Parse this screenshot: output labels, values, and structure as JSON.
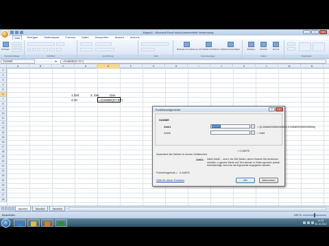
{
  "window": {
    "title": "Mappe1 - Microsoft Excel nicht-kommerzielle Verwendung"
  },
  "ribbon": {
    "tabs": [
      "Start",
      "Einfügen",
      "Seitenlayout",
      "Formeln",
      "Daten",
      "Überprüfen",
      "Ansicht",
      "Add-Ins"
    ],
    "groups": [
      "Zwischenablage",
      "Schriftart",
      "Ausrichtung",
      "Zahl",
      "Formatvorlagen",
      "Zellen",
      "Bearbeiten"
    ],
    "paste_label": "Einfügen",
    "style_buttons": [
      "Bedingte Formatierung",
      "Als Tabelle formatieren",
      "Zellenformatvorlagen"
    ],
    "cell_buttons": [
      "Einfügen",
      "Löschen",
      "Format"
    ]
  },
  "formula_bar": {
    "name_box": "SUMME",
    "fx": "fx",
    "content": "=SUMME(D7:E7)"
  },
  "sheet": {
    "columns": [
      "A",
      "B",
      "C",
      "D",
      "E",
      "F",
      "G",
      "H",
      "I",
      "J",
      "K",
      "L",
      "M",
      "N"
    ],
    "rows": [
      "1",
      "2",
      "3",
      "4",
      "5",
      "6",
      "7",
      "8",
      "9",
      "10",
      "11",
      "12",
      "13",
      "14",
      "15",
      "16",
      "17",
      "18",
      "19",
      "20",
      "21",
      "22",
      "23",
      "24",
      "25",
      "26",
      "27",
      "28"
    ],
    "cells": {
      "c5": "1.Zeit",
      "c6": "2:10",
      "d5": "2. Zeit",
      "e5": "Ges",
      "e6": "=SUMME(D7:E7)"
    },
    "tabs": [
      "Tabelle1",
      "Tabelle2",
      "Tabelle3"
    ]
  },
  "status_bar": {
    "mode": "Bearbeiten",
    "zoom": "100 %"
  },
  "dialog": {
    "title": "Funktionsargumente",
    "help": "?",
    "close": "x",
    "function_name": "SUMME",
    "args": [
      {
        "label": "Zahl1",
        "value": "D7:E7",
        "result": "= {0,0868055555555556,0,0868055555555556}"
      },
      {
        "label": "Zahl2",
        "value": "",
        "result": "= Zahl"
      }
    ],
    "result_mid": "= 0,16875",
    "description": "Summiert die Zahlen in einem Zellbereich.",
    "arg_desc_label": "Zahl1:",
    "arg_desc": "Zahl1;Zahl2;... sind 1 bis 255 Zahlen, deren Summe Sie berechnen möchten. Logische Werte und Text werden in Zellen ignoriert, jedoch berücksichtigt, wenn sie als Argumente eingegeben werden.",
    "result_label": "Formelergebnis =",
    "result_value": "0,16875",
    "help_link": "Hilfe für diese Funktion",
    "ok": "OK",
    "cancel": "Abbrechen"
  },
  "taskbar": {
    "clock_time": "14:33",
    "clock_date": "30.10.2012"
  },
  "colors": {
    "ribbon": "#dfe9f6",
    "selection_header": "#f8d98b",
    "link": "#1f4fb3"
  }
}
